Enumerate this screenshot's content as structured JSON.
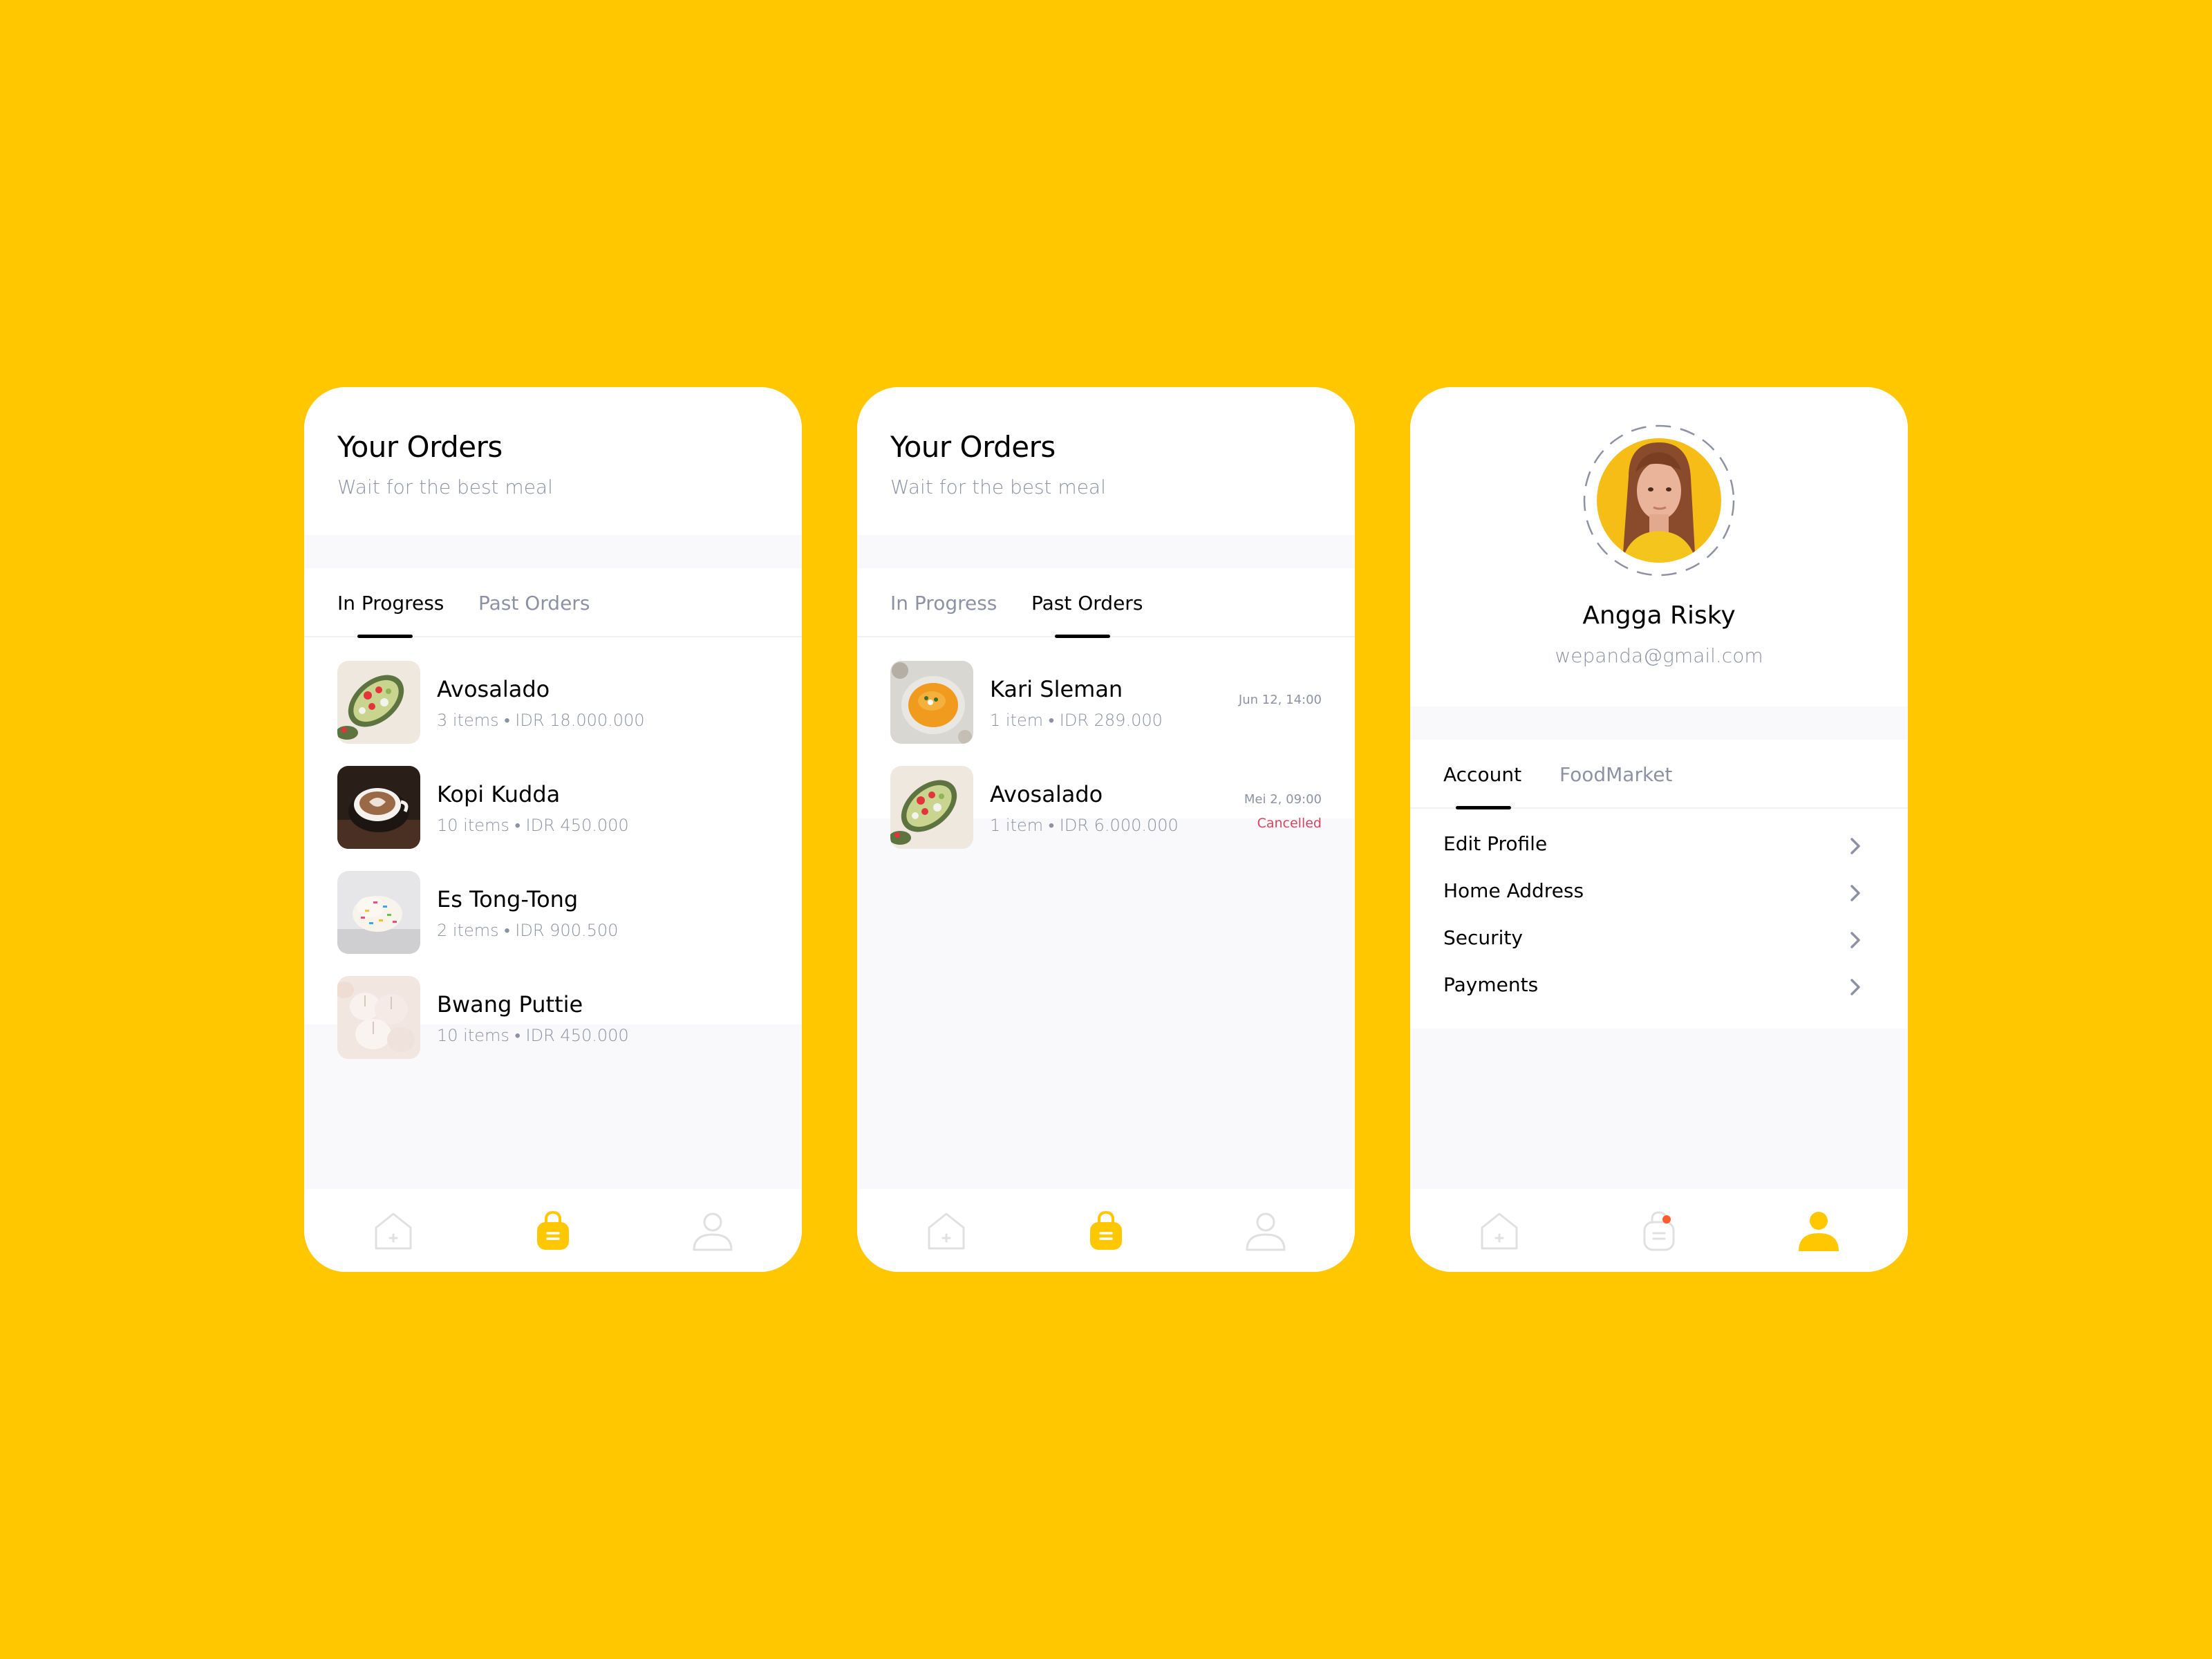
{
  "orders": {
    "title": "Your Orders",
    "subtitle": "Wait for the best meal",
    "tab_in_progress": "In Progress",
    "tab_past": "Past Orders",
    "in_progress_items": [
      {
        "name": "Avosalado",
        "meta": "3 items • IDR 18.000.000",
        "image": "avocado-salad"
      },
      {
        "name": "Kopi Kudda",
        "meta": "10 items • IDR 450.000",
        "image": "latte-coffee"
      },
      {
        "name": "Es Tong-Tong",
        "meta": "2 items • IDR 900.500",
        "image": "ice-cream-sprinkles"
      },
      {
        "name": "Bwang Puttie",
        "meta": "10 items • IDR 450.000",
        "image": "garlic-bulbs"
      }
    ],
    "past_items": [
      {
        "name": "Kari Sleman",
        "meta": "1 item • IDR 289.000",
        "date": "Jun 12, 14:00",
        "status": "",
        "image": "curry-soup"
      },
      {
        "name": "Avosalado",
        "meta": "1 item • IDR 6.000.000",
        "date": "Mei 2, 09:00",
        "status": "Cancelled",
        "image": "avocado-salad"
      }
    ]
  },
  "profile": {
    "name": "Angga Risky",
    "email": "wepanda@gmail.com",
    "tab_account": "Account",
    "tab_foodmarket": "FoodMarket",
    "menu": [
      {
        "label": "Edit Profile"
      },
      {
        "label": "Home Address"
      },
      {
        "label": "Security"
      },
      {
        "label": "Payments"
      }
    ]
  },
  "nav": {
    "icons": [
      "home-icon",
      "orders-bag-icon",
      "profile-icon"
    ],
    "active_color": "#FFC700",
    "inactive_color": "#E0E0E0",
    "notification_color": "#FF5B2E"
  },
  "colors": {
    "background": "#FFC700",
    "text_primary": "#020202",
    "text_secondary": "#8D92A3",
    "cancelled": "#D9435E"
  }
}
